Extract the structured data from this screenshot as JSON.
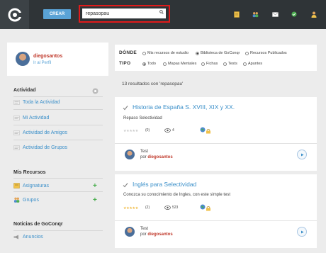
{
  "topbar": {
    "create_label": "CREAR",
    "search_value": "repasopau"
  },
  "profile": {
    "name": "diegosantos",
    "link": "Ir al Perfil"
  },
  "sidebar": {
    "activity_title": "Actividad",
    "activity_items": [
      "Toda la Actividad",
      "Mi Actividad",
      "Actividad de Amigos",
      "Actividad de Grupos"
    ],
    "resources_title": "Mis Recursos",
    "resources_items": [
      "Asignaturas",
      "Grupos"
    ],
    "news_title": "Noticias de GoConqr",
    "news_items": [
      "Anuncios"
    ]
  },
  "filter": {
    "where_label": "DÓNDE",
    "where_options": [
      "Mis recursos de estudio",
      "Biblioteca de GoConqr",
      "Recursos Publicados"
    ],
    "where_selected": 1,
    "type_label": "TIPO",
    "type_options": [
      "Todo",
      "Mapas Mentales",
      "Fichas",
      "Tests",
      "Apuntes"
    ],
    "type_selected": 0
  },
  "results": {
    "count_text": "13 resultados con 'repasopau'",
    "items": [
      {
        "title": "Historia de España S. XVIII, XIX y XX.",
        "description": "Repaso Selectividad",
        "rating_count": "(0)",
        "rating": 0,
        "views": "4",
        "kind": "Test",
        "by_prefix": "por",
        "author": "diegosantos"
      },
      {
        "title": "Inglés para Selectividad",
        "description": "Conozca su conocimiento de Ingles, con este simple test",
        "rating_count": "(2)",
        "rating": 5,
        "views": "523",
        "kind": "Test",
        "by_prefix": "por",
        "author": "diegosantos"
      }
    ]
  },
  "colors": {
    "topbar": "#2f3437",
    "accent": "#5aa3d6",
    "link": "#3a8fc9",
    "highlight": "#e01b1b",
    "author": "#c0392b",
    "plus": "#4caf50"
  }
}
